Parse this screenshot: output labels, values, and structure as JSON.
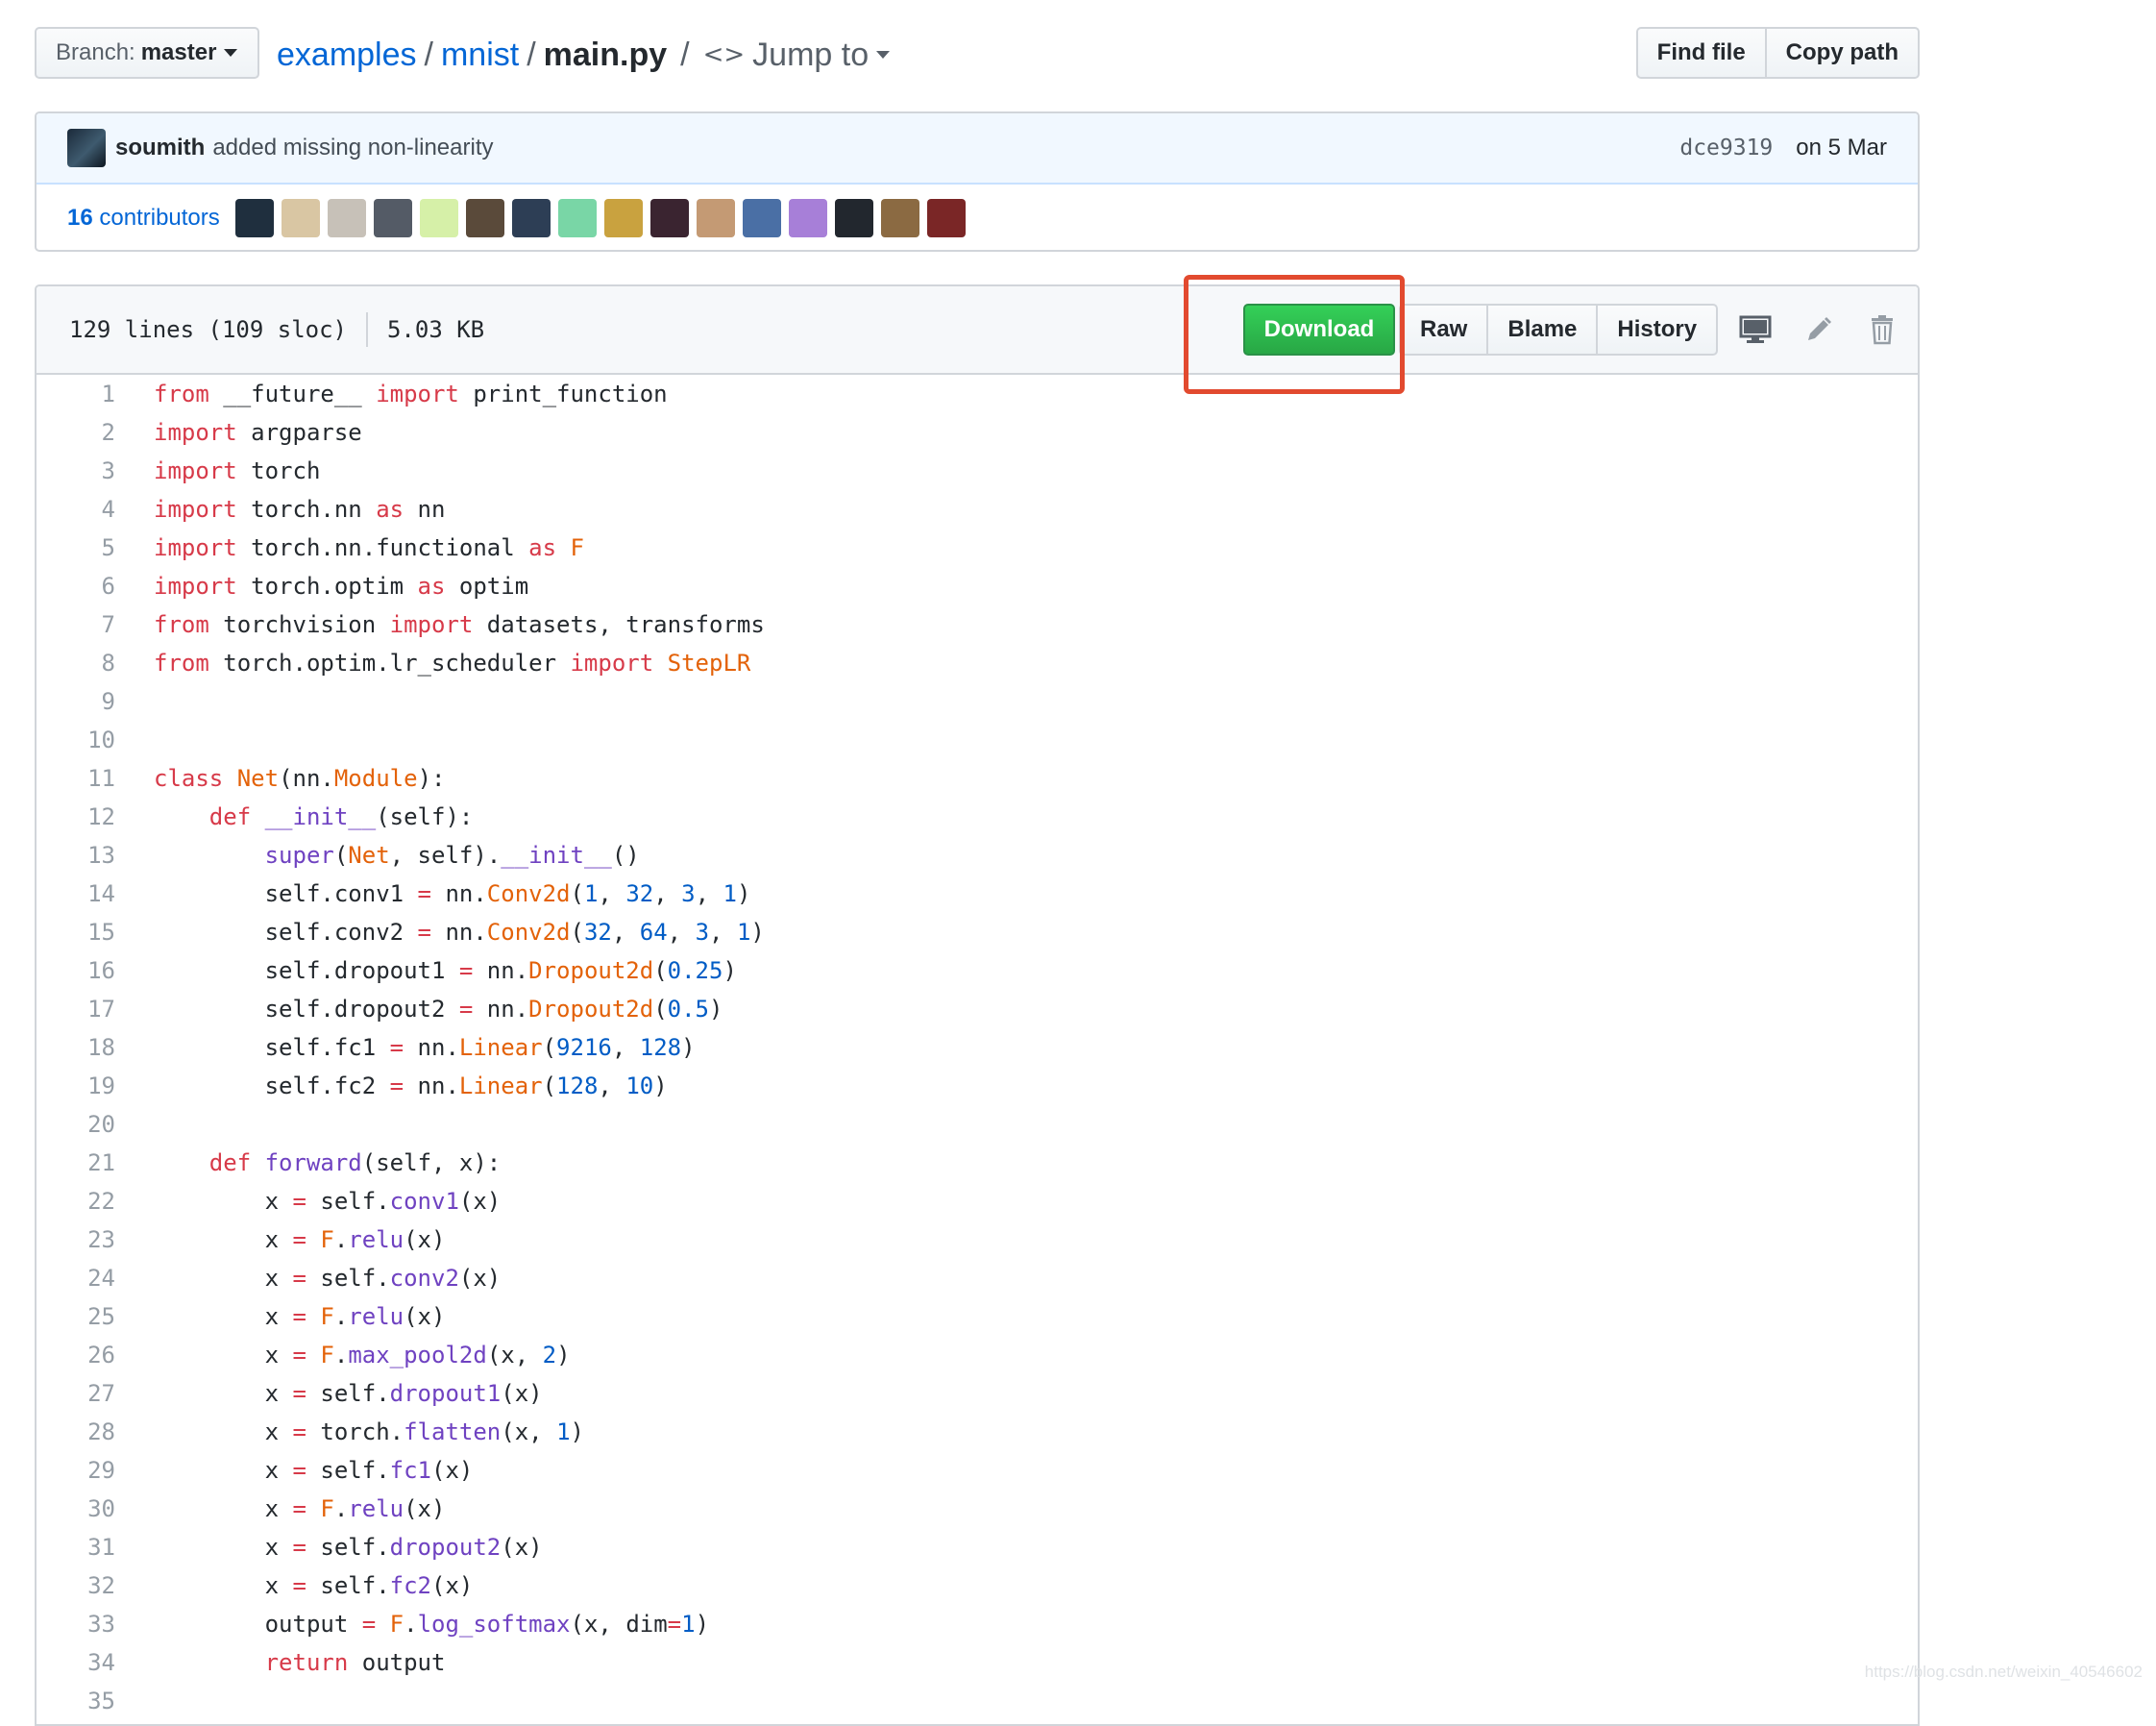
{
  "file_nav": {
    "branch_label": "Branch:",
    "branch_value": "master",
    "breadcrumb": [
      "examples",
      "mnist",
      "main.py"
    ],
    "separator": "/",
    "jump_to": "Jump to",
    "find_file": "Find file",
    "copy_path": "Copy path"
  },
  "commit": {
    "author": "soumith",
    "message": "added missing non-linearity",
    "sha": "dce9319",
    "date": "on 5 Mar"
  },
  "contributors": {
    "count_number": "16",
    "count_word": "contributors",
    "avatar_colors": [
      "#1f2f3e",
      "#d9c6a3",
      "#c7c1b8",
      "#545b66",
      "#d6f0a8",
      "#5a4a3a",
      "#2d3e55",
      "#79d6a6",
      "#c9a23f",
      "#3a2430",
      "#c49a74",
      "#4a6fa5",
      "#a77fd8",
      "#22272e",
      "#8b6a42",
      "#7a2626"
    ]
  },
  "file": {
    "lines_info": "129 lines (109 sloc)",
    "size": "5.03 KB",
    "download": "Download",
    "raw": "Raw",
    "blame": "Blame",
    "history": "History"
  },
  "code_lines": [
    {
      "n": "1",
      "src": "from __future__ import print_function"
    },
    {
      "n": "2",
      "src": "import argparse"
    },
    {
      "n": "3",
      "src": "import torch"
    },
    {
      "n": "4",
      "src": "import torch.nn as nn"
    },
    {
      "n": "5",
      "src": "import torch.nn.functional as F"
    },
    {
      "n": "6",
      "src": "import torch.optim as optim"
    },
    {
      "n": "7",
      "src": "from torchvision import datasets, transforms"
    },
    {
      "n": "8",
      "src": "from torch.optim.lr_scheduler import StepLR"
    },
    {
      "n": "9",
      "src": ""
    },
    {
      "n": "10",
      "src": ""
    },
    {
      "n": "11",
      "src": "class Net(nn.Module):"
    },
    {
      "n": "12",
      "src": "    def __init__(self):"
    },
    {
      "n": "13",
      "src": "        super(Net, self).__init__()"
    },
    {
      "n": "14",
      "src": "        self.conv1 = nn.Conv2d(1, 32, 3, 1)"
    },
    {
      "n": "15",
      "src": "        self.conv2 = nn.Conv2d(32, 64, 3, 1)"
    },
    {
      "n": "16",
      "src": "        self.dropout1 = nn.Dropout2d(0.25)"
    },
    {
      "n": "17",
      "src": "        self.dropout2 = nn.Dropout2d(0.5)"
    },
    {
      "n": "18",
      "src": "        self.fc1 = nn.Linear(9216, 128)"
    },
    {
      "n": "19",
      "src": "        self.fc2 = nn.Linear(128, 10)"
    },
    {
      "n": "20",
      "src": ""
    },
    {
      "n": "21",
      "src": "    def forward(self, x):"
    },
    {
      "n": "22",
      "src": "        x = self.conv1(x)"
    },
    {
      "n": "23",
      "src": "        x = F.relu(x)"
    },
    {
      "n": "24",
      "src": "        x = self.conv2(x)"
    },
    {
      "n": "25",
      "src": "        x = F.relu(x)"
    },
    {
      "n": "26",
      "src": "        x = F.max_pool2d(x, 2)"
    },
    {
      "n": "27",
      "src": "        x = self.dropout1(x)"
    },
    {
      "n": "28",
      "src": "        x = torch.flatten(x, 1)"
    },
    {
      "n": "29",
      "src": "        x = self.fc1(x)"
    },
    {
      "n": "30",
      "src": "        x = F.relu(x)"
    },
    {
      "n": "31",
      "src": "        x = self.dropout2(x)"
    },
    {
      "n": "32",
      "src": "        x = self.fc2(x)"
    },
    {
      "n": "33",
      "src": "        output = F.log_softmax(x, dim=1)"
    },
    {
      "n": "34",
      "src": "        return output"
    },
    {
      "n": "35",
      "src": ""
    }
  ],
  "watermark": "https://blog.csdn.net/weixin_40546602"
}
